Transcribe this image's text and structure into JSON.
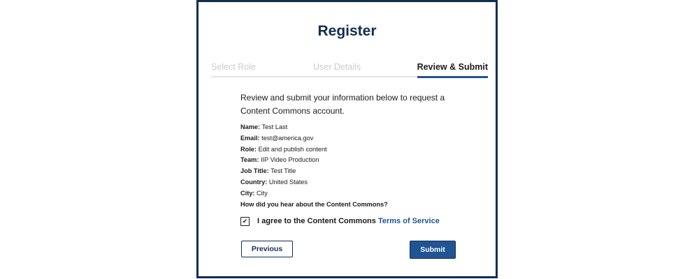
{
  "title": "Register",
  "steps": [
    "Select Role",
    "User Details",
    "Review & Submit"
  ],
  "active_step": "Review & Submit",
  "intro": "Review and submit your information below to request a Content Commons account.",
  "details": [
    {
      "label": "Name:",
      "value": "Test Last"
    },
    {
      "label": "Email:",
      "value": "test@america.gov"
    },
    {
      "label": "Role:",
      "value": "Edit and publish content"
    },
    {
      "label": "Team:",
      "value": "IIP Video Production"
    },
    {
      "label": "Job Title:",
      "value": "Test Title"
    },
    {
      "label": "Country:",
      "value": "United States"
    },
    {
      "label": "City:",
      "value": "City"
    },
    {
      "label": "How did you hear about the Content Commons?",
      "value": ""
    }
  ],
  "agree": {
    "checked": true,
    "text": "I agree to the Content Commons",
    "link": "Terms of Service"
  },
  "buttons": {
    "previous": "Previous",
    "submit": "Submit"
  },
  "colors": {
    "navy": "#112e51",
    "primary": "#205493",
    "inactive": "#c9cdd2"
  }
}
